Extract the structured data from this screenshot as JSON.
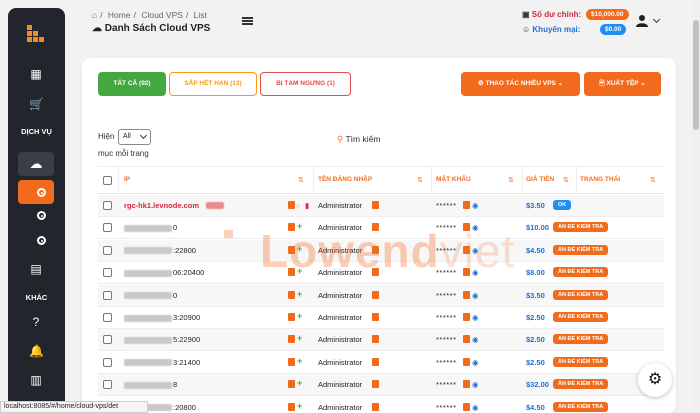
{
  "header": {
    "breadcrumb": [
      "Home",
      "Cloud VPS",
      "List"
    ],
    "title": "Danh Sách Cloud VPS",
    "balance_label": "Số dư chính:",
    "balance_value": "$10,000.00",
    "promo_label": "Khuyến mại:",
    "promo_value": "$0.00"
  },
  "sidebar": {
    "section_services": "DỊCH VỤ",
    "section_other": "KHÁC"
  },
  "tabs": {
    "all": "TẤT CẢ (92)",
    "expiring": "SẮP HẾT HẠN (13)",
    "suspended": "BỊ TẠM NGƯNG (1)"
  },
  "actions": {
    "multi": "⚙ THAO TÁC NHIỀU VPS ⌄",
    "export": "🖹 XUẤT TỆP ⌄"
  },
  "filters": {
    "show_label": "Hiện",
    "show_value": "All",
    "per_page": "mục mỗi trang",
    "search": "Tìm kiếm"
  },
  "table": {
    "columns": [
      "IP",
      "TÊN ĐĂNG NHẬP",
      "MẬT KHẨU",
      "GIÁ TIỀN",
      "TRẠNG THÁI"
    ],
    "rows": [
      {
        "ip": "rgc-hk1.levnode.com",
        "ip_suffix": "",
        "user": "Administrator",
        "password": "******",
        "price": "$3.50",
        "status": "OK"
      },
      {
        "ip": "",
        "ip_suffix": "0",
        "user": "Administrator",
        "password": "******",
        "price": "$10.00",
        "status": "ẨN ĐỂ KIỂM TRA"
      },
      {
        "ip": "",
        "ip_suffix": ":22800",
        "user": "Administrator",
        "password": "******",
        "price": "$4.50",
        "status": "ẨN ĐỂ KIỂM TRA"
      },
      {
        "ip": "",
        "ip_suffix": "06:20400",
        "user": "Administrator",
        "password": "******",
        "price": "$8.00",
        "status": "ẨN ĐỂ KIỂM TRA"
      },
      {
        "ip": "",
        "ip_suffix": "0",
        "user": "Administrator",
        "password": "******",
        "price": "$3.50",
        "status": "ẨN ĐỂ KIỂM TRA"
      },
      {
        "ip": "",
        "ip_suffix": "3:20900",
        "user": "Administrator",
        "password": "******",
        "price": "$2.50",
        "status": "ẨN ĐỂ KIỂM TRA"
      },
      {
        "ip": "",
        "ip_suffix": "5:22900",
        "user": "Administrator",
        "password": "******",
        "price": "$2.50",
        "status": "ẨN ĐỂ KIỂM TRA"
      },
      {
        "ip": "",
        "ip_suffix": "3:21400",
        "user": "Administrator",
        "password": "******",
        "price": "$2.50",
        "status": "ẨN ĐỂ KIỂM TRA"
      },
      {
        "ip": "",
        "ip_suffix": "8",
        "user": "Administrator",
        "password": "******",
        "price": "$32.00",
        "status": "ẨN ĐỂ KIỂM TRA"
      },
      {
        "ip": "",
        "ip_suffix": ":20800",
        "user": "Administrator",
        "password": "******",
        "price": "$4.50",
        "status": "ẨN ĐỂ KIỂM TRA"
      }
    ]
  },
  "watermark": {
    "main": "Lowend",
    "accent": "viet"
  },
  "status_bar": "localhost:8085/#/home/cloud-vps/det",
  "colors": {
    "accent": "#f26b1d",
    "green": "#43a83f",
    "blue": "#1f6fd1",
    "red": "#d7263d"
  }
}
